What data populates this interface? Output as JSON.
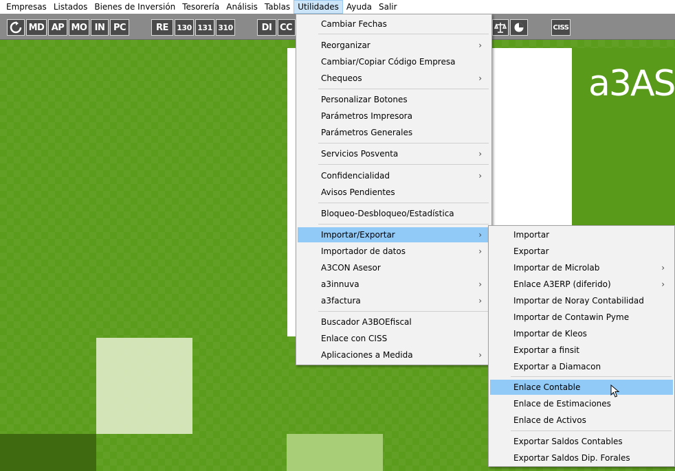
{
  "menubar": {
    "items": [
      "Empresas",
      "Listados",
      "Bienes de Inversión",
      "Tesorería",
      "Análisis",
      "Tablas",
      "Utilidades",
      "Ayuda",
      "Salir"
    ],
    "active": "Utilidades"
  },
  "toolbar": {
    "buttons": [
      "MD",
      "AP",
      "MO",
      "IN",
      "PC",
      "RE",
      "130",
      "131",
      "310",
      "DI",
      "CC",
      "CISS"
    ]
  },
  "brand": "a3AS",
  "utilidades_menu": {
    "items": [
      {
        "label": "Cambiar Fechas"
      },
      {
        "label": "Reorganizar",
        "submenu": true
      },
      {
        "label": "Cambiar/Copiar Código Empresa"
      },
      {
        "label": "Chequeos",
        "submenu": true
      },
      {
        "label": "Personalizar Botones"
      },
      {
        "label": "Parámetros Impresora"
      },
      {
        "label": "Parámetros Generales"
      },
      {
        "label": "Servicios Posventa",
        "submenu": true
      },
      {
        "label": "Confidencialidad",
        "submenu": true
      },
      {
        "label": "Avisos Pendientes"
      },
      {
        "label": "Bloqueo-Desbloqueo/Estadística"
      },
      {
        "label": "Importar/Exportar",
        "submenu": true,
        "highlighted": true
      },
      {
        "label": "Importador de datos",
        "submenu": true
      },
      {
        "label": "A3CON Asesor"
      },
      {
        "label": "a3innuva",
        "submenu": true
      },
      {
        "label": "a3factura",
        "submenu": true
      },
      {
        "label": "Buscador A3BOEfiscal"
      },
      {
        "label": "Enlace con CISS"
      },
      {
        "label": "Aplicaciones a Medida",
        "submenu": true
      }
    ]
  },
  "importar_menu": {
    "items": [
      {
        "label": "Importar"
      },
      {
        "label": "Exportar"
      },
      {
        "label": "Importar de Microlab",
        "submenu": true
      },
      {
        "label": "Enlace A3ERP (diferido)",
        "submenu": true
      },
      {
        "label": "Importar de Noray Contabilidad"
      },
      {
        "label": "Importar de Contawin Pyme"
      },
      {
        "label": "Importar de Kleos"
      },
      {
        "label": "Exportar a finsit"
      },
      {
        "label": "Exportar a Diamacon"
      },
      {
        "label": "Enlace Contable",
        "highlighted": true
      },
      {
        "label": "Enlace de Estimaciones"
      },
      {
        "label": "Enlace de Activos"
      },
      {
        "label": "Exportar Saldos Contables"
      },
      {
        "label": "Exportar Saldos Dip. Forales"
      }
    ]
  },
  "arrow_glyph": "›"
}
